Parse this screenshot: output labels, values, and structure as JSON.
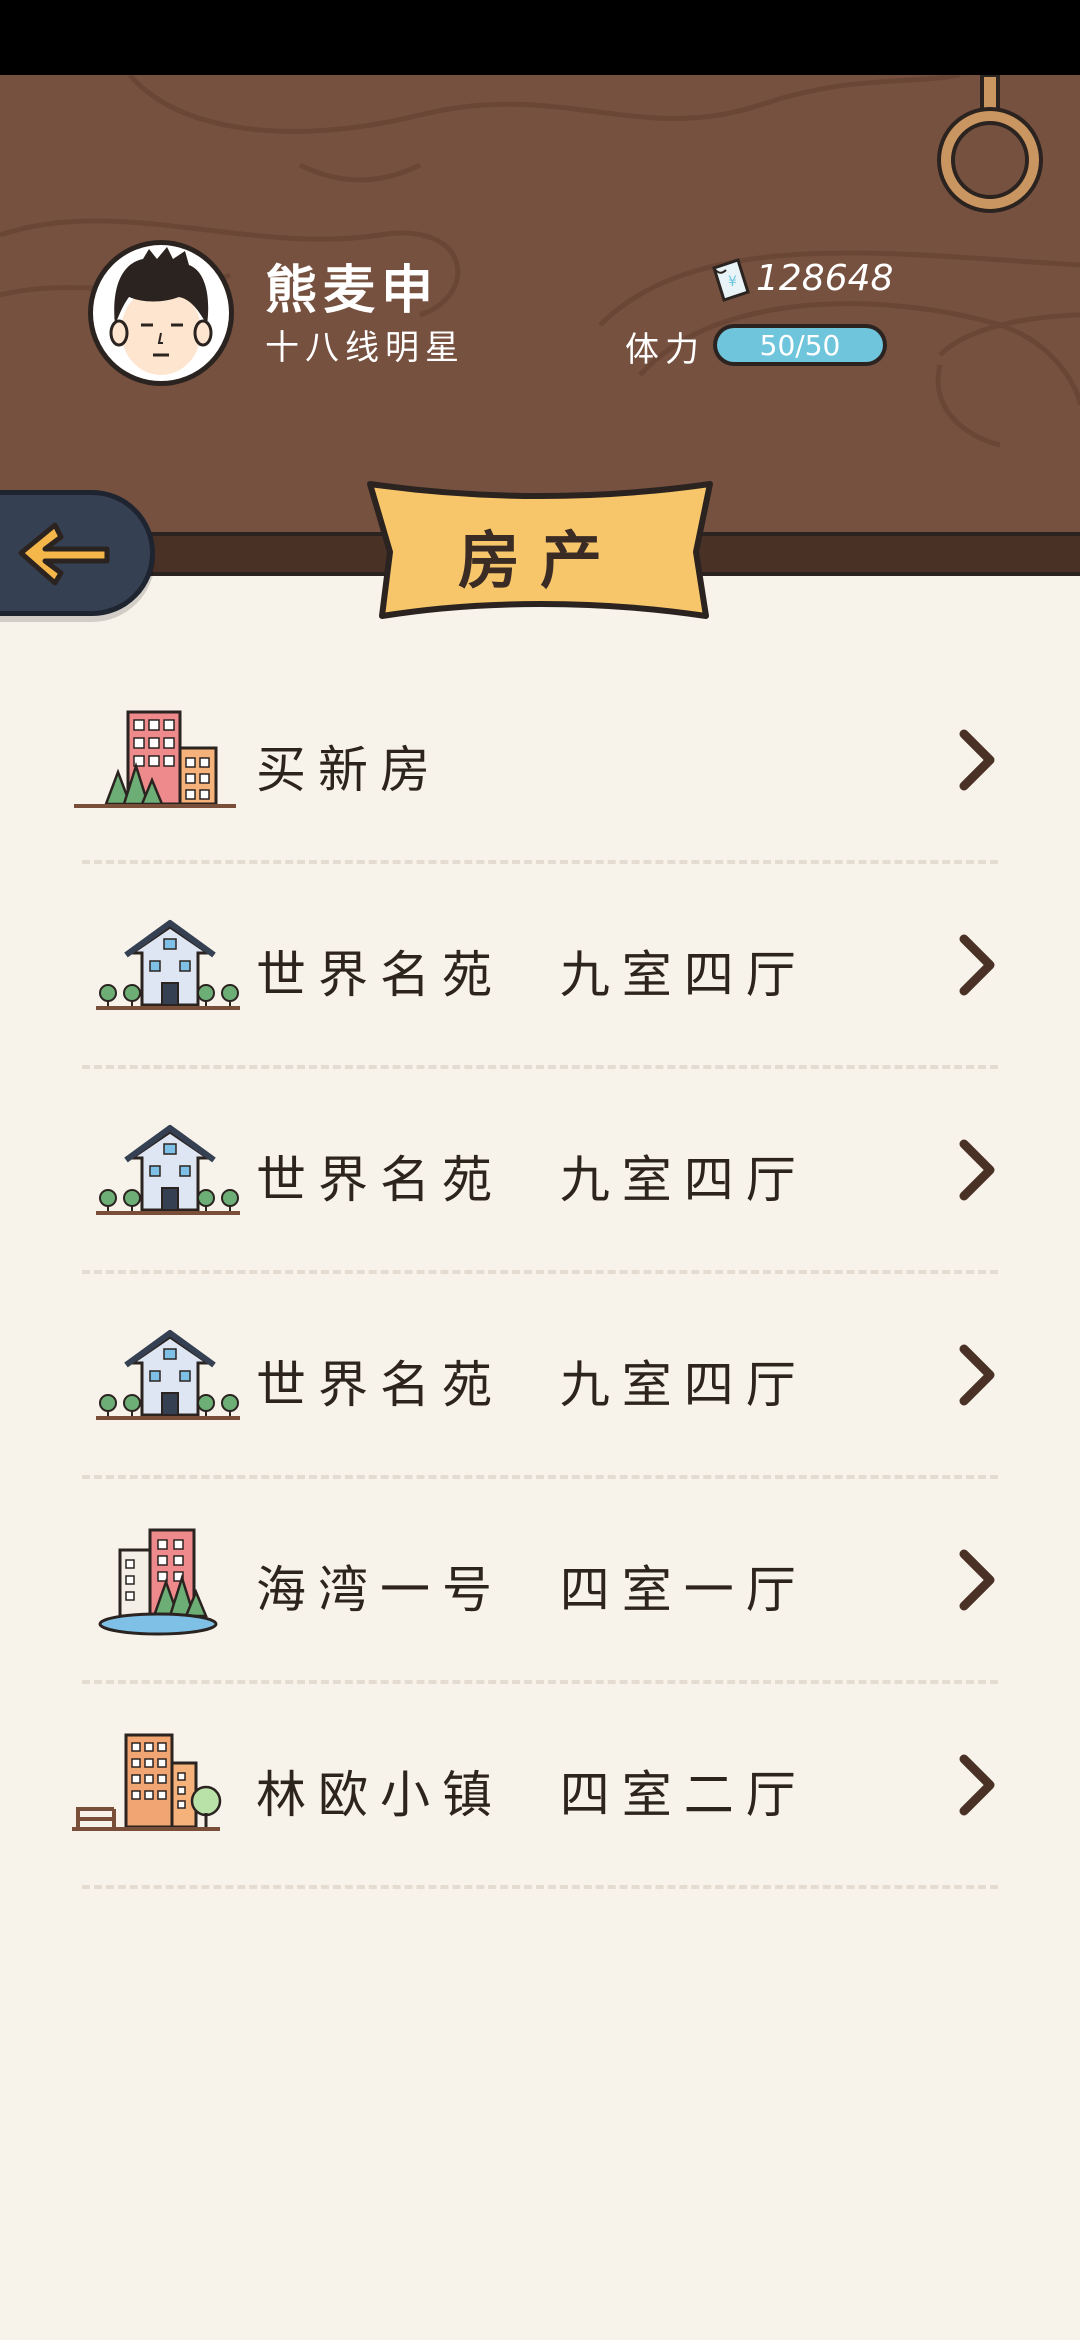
{
  "player": {
    "name": "熊麦申",
    "title": "十八线明星",
    "money": "128648",
    "stamina_label": "体力",
    "stamina": "50/50",
    "stamina_fraction": 1.0
  },
  "page": {
    "title": "房产"
  },
  "nav": {
    "back_icon": "back-arrow-icon"
  },
  "properties": [
    {
      "label": "买新房",
      "icon": "buy-house-icon"
    },
    {
      "label": "世界名苑  九室四厅",
      "icon": "villa-icon"
    },
    {
      "label": "世界名苑  九室四厅",
      "icon": "villa-icon"
    },
    {
      "label": "世界名苑  九室四厅",
      "icon": "villa-icon"
    },
    {
      "label": "海湾一号  四室一厅",
      "icon": "bay-apartment-icon"
    },
    {
      "label": "林欧小镇  四室二厅",
      "icon": "town-building-icon"
    }
  ],
  "colors": {
    "header": "#77513f",
    "background": "#f7f3ea",
    "banner": "#f7c56a",
    "stamina": "#6ec5dc",
    "back_button": "#364053",
    "back_arrow": "#f5b64a"
  }
}
